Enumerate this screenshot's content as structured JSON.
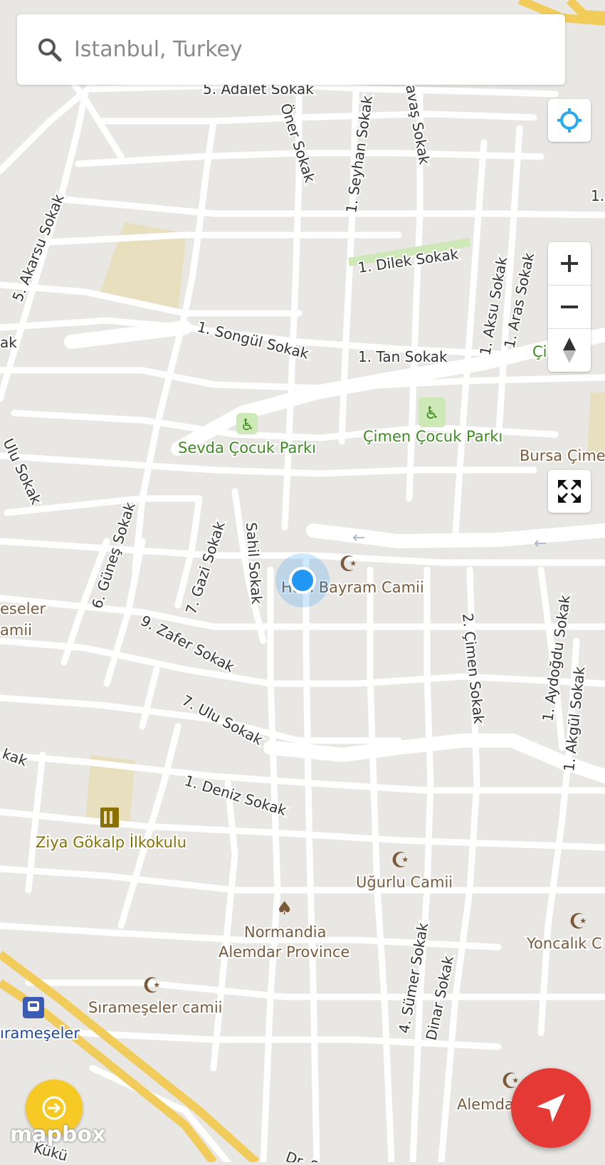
{
  "search": {
    "placeholder": "Istanbul, Turkey"
  },
  "attribution": "mapbox",
  "colors": {
    "land": "#e9e7e3",
    "road": "#ffffff",
    "highway": "#f1cc5a",
    "park": "#cfe8b8",
    "school_area": "#e8dfbe",
    "park_label": "#3b8d1d",
    "poi_label": "#7a5a3a",
    "street_label": "#333333",
    "user_dot": "#2196f3",
    "fab_red": "#e53935",
    "fab_yellow": "#f6c925"
  },
  "streets": [
    "5. Adalet Sokak",
    "Öner Sokak",
    "1. Seyhan Sokak",
    "Savaş Sokak",
    "5. Akarsu Sokak",
    "1. Dilek Sokak",
    "1. Aksu Sokak",
    "1. Aras Sokak",
    "1. Songül Sokak",
    "1. Tan Sokak",
    "Ulu Sokak",
    "6. Güneş Sokak",
    "7. Gazi Sokak",
    "Sahil Sokak",
    "9. Zafer Sokak",
    "2. Çimen Sokak",
    "1. Aydoğdu Sokak",
    "1. Akgül Sokak",
    "7. Ulu Sokak",
    "1. Deniz Sokak",
    "4. Sümer Sokak",
    "Dinar Sokak"
  ],
  "places": {
    "sevda_park": "Sevda Çocuk Parkı",
    "cimen_park": "Çimen Çocuk Parkı",
    "bursa_cimen": "Bursa Çime",
    "haci_bayram": "Hacı Bayram Camii",
    "siramese_left": "eseler",
    "siramese_left2": "amii",
    "ziya": "Ziya Gökalp İlkokulu",
    "ugurlu": "Uğurlu Camii",
    "normandia1": "Normandia",
    "normandia2": "Alemdar Province",
    "yoncalik": "Yoncalık C",
    "sirameseler_camii": "Sıramеşeler camii",
    "sirameseler": "ıramеşeler",
    "alemdar": "Alemda",
    "ci_label": "Çi",
    "dr": "Dr. S",
    "kuk": "Kükü",
    "one_left": "1.",
    "ak_left": "ak",
    "kak_left": "kak"
  },
  "icons": {
    "search": "search-icon",
    "locate": "crosshair-icon",
    "zoom_in": "plus-icon",
    "zoom_out": "minus-icon",
    "compass": "compass-icon",
    "fullscreen": "fullscreen-icon",
    "navigate": "navigation-arrow-icon",
    "arrow": "arrow-right-icon"
  }
}
